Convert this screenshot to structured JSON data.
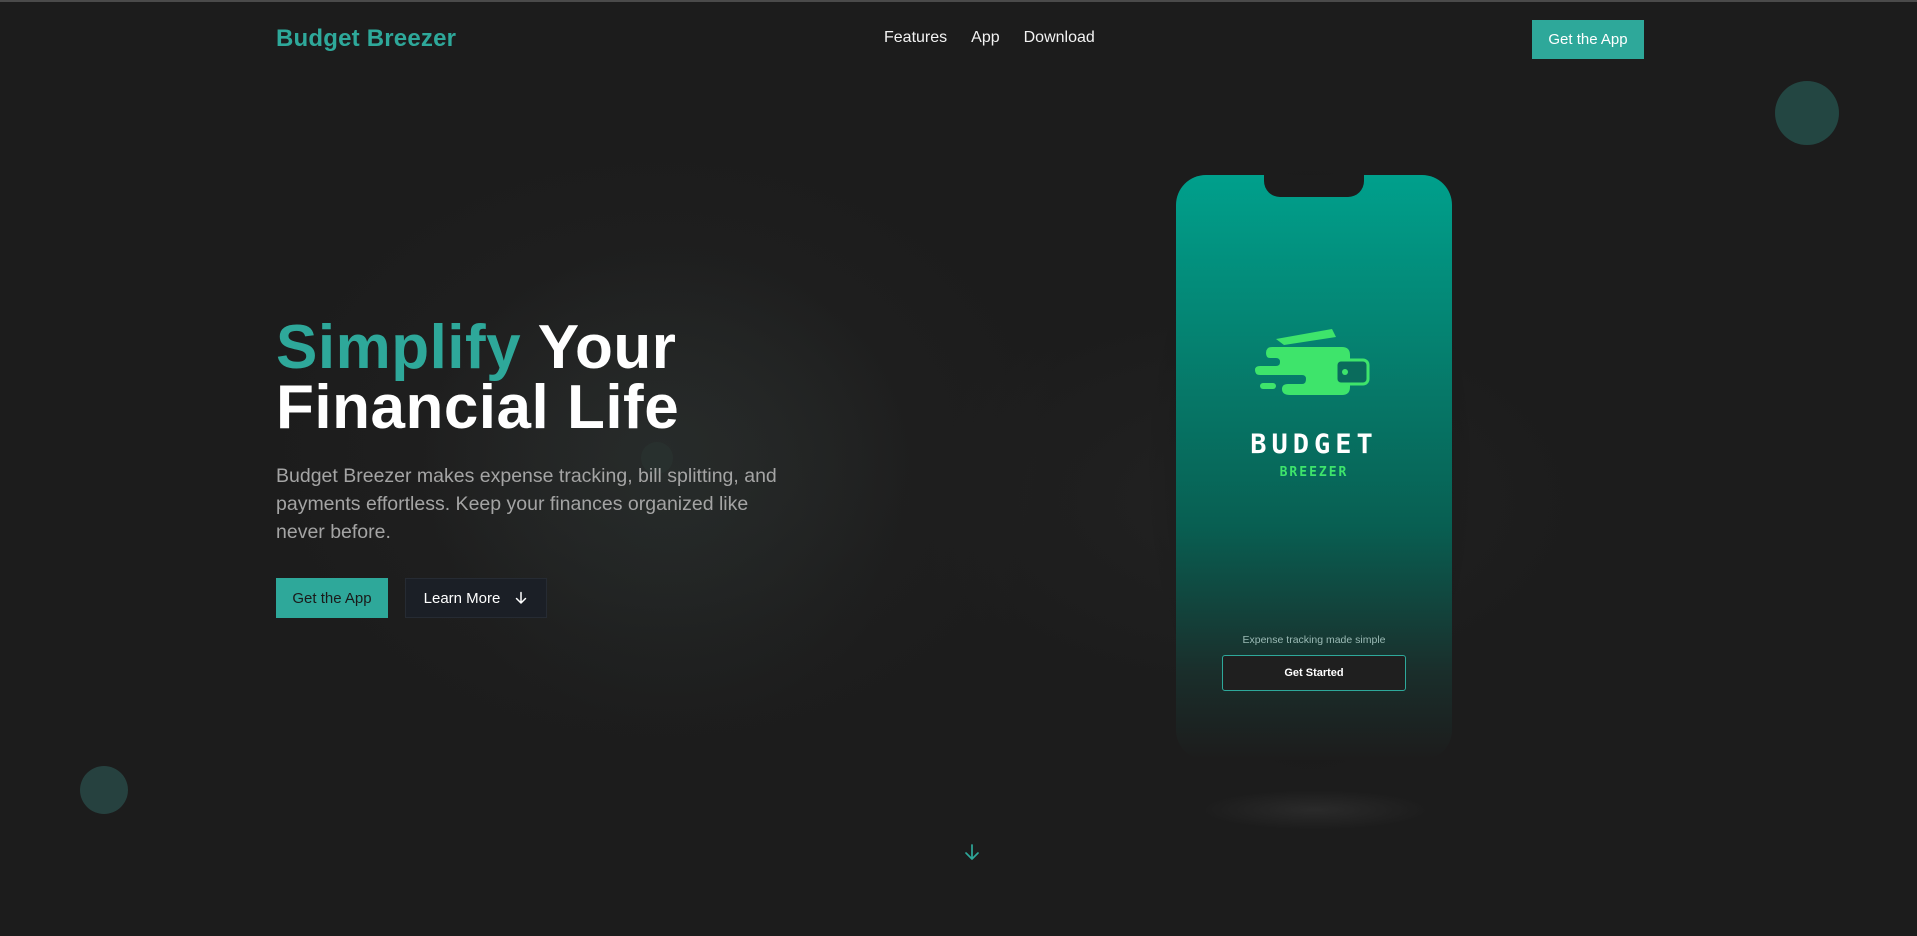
{
  "brand": {
    "name": "Budget Breezer"
  },
  "nav": {
    "links": [
      "Features",
      "App",
      "Download"
    ],
    "cta_label": "Get the App"
  },
  "hero": {
    "title_accent": "Simplify",
    "title_rest_line1": " Your",
    "title_line2": "Financial Life",
    "subtitle": "Budget Breezer makes expense tracking, bill splitting, and payments effortless. Keep your finances organized like never before.",
    "primary_label": "Get the App",
    "secondary_label": "Learn More"
  },
  "phone": {
    "logo_word": "BUDGET",
    "logo_word2": "BREEZER",
    "tagline": "Expense tracking made simple",
    "cta_label": "Get Started"
  },
  "colors": {
    "accent": "#2ea89a",
    "background": "#1c1c1c",
    "logo_green": "#3ee46b"
  },
  "icons": {
    "learn_more": "arrow-down-icon",
    "scroll": "arrow-down-icon",
    "logo": "wallet-icon"
  }
}
